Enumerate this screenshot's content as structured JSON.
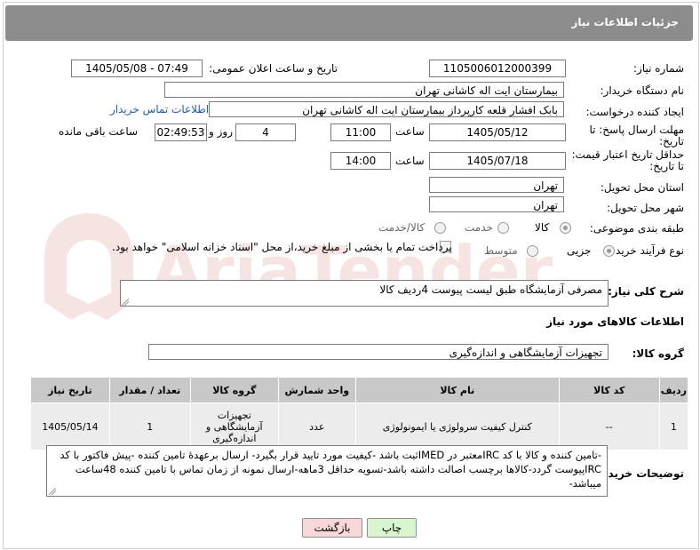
{
  "header": {
    "title": "جزئیات اطلاعات نیاز"
  },
  "form": {
    "need_number": {
      "label": "شماره نیاز:",
      "value": "1105006012000399"
    },
    "announce_datetime": {
      "label": "تاریخ و ساعت اعلان عمومی:",
      "value": "1405/05/08 - 07:49"
    },
    "buyer_org": {
      "label": "نام دستگاه خریدار:",
      "value": "بیمارستان ایت اله کاشانی تهران"
    },
    "requester": {
      "label": "ایجاد کننده درخواست:",
      "value": "بابک افشار قلعه کارپرداز بیمارستان ایت اله کاشانی تهران",
      "contact_link": "اطلاعات تماس خریدار"
    },
    "reply_deadline": {
      "label_line1": "مهلت ارسال پاسخ: تا",
      "label_line2": "تاریخ:",
      "date": "1405/05/12",
      "time_label": "ساعت",
      "time": "11:00",
      "days": "4",
      "days_label": "روز و",
      "remaining": "02:49:53",
      "remaining_label": "ساعت باقی مانده"
    },
    "price_validity": {
      "label_line1": "حداقل تاریخ اعتبار قیمت:",
      "label_line2": "تا تاریخ:",
      "date": "1405/07/18",
      "time_label": "ساعت",
      "time": "14:00"
    },
    "delivery_province": {
      "label": "استان محل تحویل:",
      "value": "تهران"
    },
    "delivery_city": {
      "label": "شهر محل تحویل:",
      "value": "تهران"
    },
    "category": {
      "label": "طبقه بندی موضوعی:",
      "options": [
        "کالا",
        "خدمت",
        "کالا/خدمت"
      ],
      "selected": "کالا"
    },
    "purchase_type": {
      "label": "نوع فرآیند خرید :",
      "options": [
        "جزیی",
        "متوسط"
      ],
      "selected": "جزیی",
      "payment_note": "پرداخت تمام یا بخشی از مبلغ خرید،از محل \"اسناد خزانه اسلامی\" خواهد بود."
    }
  },
  "summary": {
    "label": "شرح کلی نیاز:",
    "value": "مصرفی آزمایشگاه طبق لیست پیوست 4ردیف کالا"
  },
  "goods_info": {
    "section_title": "اطلاعات کالاهای مورد نیاز",
    "group_label": "گروه کالا:",
    "group_value": "تجهیزات آزمایشگاهی و اندازه‌گیری"
  },
  "table": {
    "headers": [
      "ردیف",
      "کد کالا",
      "نام کالا",
      "واحد شمارش",
      "گروه کالا",
      "تعداد / مقدار",
      "تاریخ نیاز"
    ],
    "rows": [
      [
        "1",
        "--",
        "کنترل کیفیت سرولوژی یا ایمونولوژی",
        "عدد",
        "تجهیزات آزمایشگاهی و اندازه‌گیری",
        "1",
        "1405/05/14"
      ]
    ]
  },
  "buyer_notes": {
    "label": "توضیحات خریدار:",
    "value": "-تامین کننده و کالا با کد IRCمعتبر در IMEDثبت باشد -کیفیت مورد تایید قرار بگیرد- ارسال برعهدهٔ تامین کننده -پیش فاکتور با کد IRCپیوست گردد-کالاها برچسب اصالت داشته باشد-تسویه حداقل 3ماهه-ارسال نمونه از زمان تماس با تامین کننده 48ساعت میباشد-"
  },
  "buttons": {
    "print": "چاپ",
    "back": "بازگشت"
  },
  "watermark": {
    "text": "AriaTender.net"
  },
  "colors": {
    "header_bg": "#8c8c8c",
    "link": "#1a5fb4",
    "print_btn": "#d8f5cf",
    "back_btn": "#f7d7d7",
    "watermark": "#c0392b"
  }
}
